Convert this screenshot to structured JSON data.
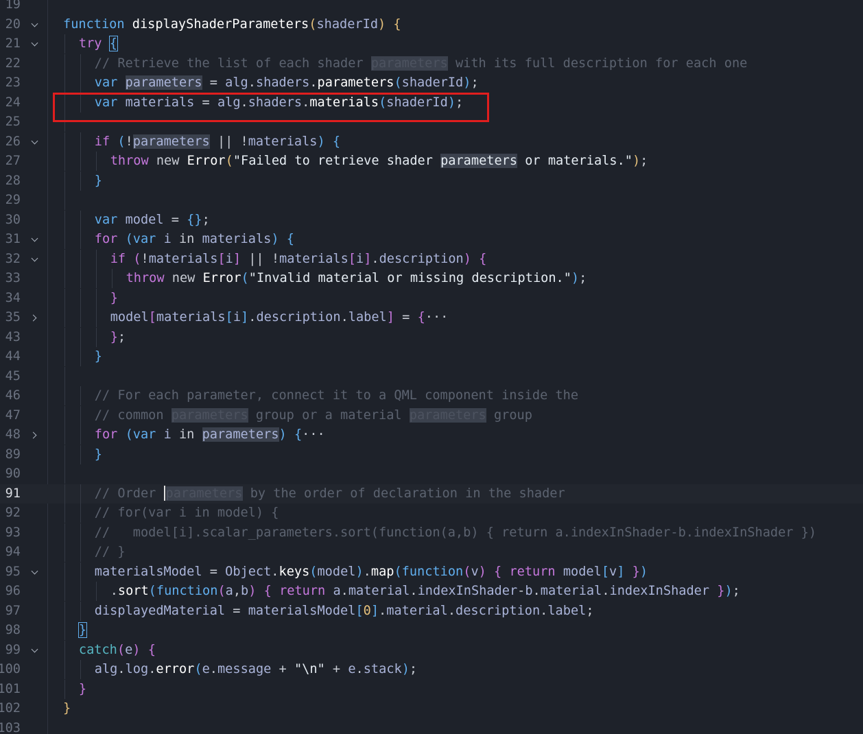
{
  "editor": {
    "current_line": 91,
    "lines": [
      {
        "n": "19",
        "fold": "",
        "segs": []
      },
      {
        "n": "20",
        "fold": "down",
        "segs": [
          [
            "kwb",
            "function"
          ],
          [
            "pl",
            " "
          ],
          [
            "fn",
            "displayShaderParameters"
          ],
          [
            "br1",
            "("
          ],
          [
            "id",
            "shaderId"
          ],
          [
            "br1",
            ")"
          ],
          [
            "pl",
            " "
          ],
          [
            "br1",
            "{"
          ]
        ]
      },
      {
        "n": "21",
        "fold": "down",
        "segs": [
          [
            "kw",
            "try"
          ],
          [
            "pl",
            " "
          ],
          [
            "br2b",
            "{"
          ]
        ]
      },
      {
        "n": "22",
        "fold": "",
        "segs": [
          [
            "cm",
            "// Retrieve the list of each shader "
          ],
          [
            "hlcm",
            "parameters"
          ],
          [
            "cm",
            " with its full description for each one"
          ]
        ]
      },
      {
        "n": "23",
        "fold": "",
        "segs": [
          [
            "kwb",
            "var"
          ],
          [
            "pl",
            " "
          ],
          [
            "hlid",
            "parameters"
          ],
          [
            "pl",
            " = "
          ],
          [
            "id",
            "alg"
          ],
          [
            "pl",
            "."
          ],
          [
            "id",
            "shaders"
          ],
          [
            "pl",
            "."
          ],
          [
            "fnh",
            "parameters"
          ],
          [
            "br3",
            "("
          ],
          [
            "id",
            "shaderId"
          ],
          [
            "br3",
            ")"
          ],
          [
            "pl",
            ";"
          ]
        ]
      },
      {
        "n": "24",
        "fold": "",
        "segs": [
          [
            "kwb",
            "var"
          ],
          [
            "pl",
            " "
          ],
          [
            "id",
            "materials"
          ],
          [
            "pl",
            " = "
          ],
          [
            "id",
            "alg"
          ],
          [
            "pl",
            "."
          ],
          [
            "id",
            "shaders"
          ],
          [
            "pl",
            "."
          ],
          [
            "fn",
            "materials"
          ],
          [
            "br3",
            "("
          ],
          [
            "id",
            "shaderId"
          ],
          [
            "br3",
            ")"
          ],
          [
            "pl",
            ";"
          ]
        ]
      },
      {
        "n": "25",
        "fold": "",
        "segs": []
      },
      {
        "n": "26",
        "fold": "down",
        "segs": [
          [
            "kw",
            "if"
          ],
          [
            "pl",
            " "
          ],
          [
            "br3",
            "("
          ],
          [
            "pl",
            "!"
          ],
          [
            "hlid",
            "parameters"
          ],
          [
            "pl",
            " || !"
          ],
          [
            "id",
            "materials"
          ],
          [
            "br3",
            ")"
          ],
          [
            "pl",
            " "
          ],
          [
            "br3",
            "{"
          ]
        ]
      },
      {
        "n": "27",
        "fold": "",
        "segs": [
          [
            "kw",
            "throw"
          ],
          [
            "pl",
            " new "
          ],
          [
            "fn",
            "Error"
          ],
          [
            "br1",
            "("
          ],
          [
            "str",
            "\"Failed to retrieve shader "
          ],
          [
            "hlstr",
            "parameters"
          ],
          [
            "str",
            " or materials.\""
          ],
          [
            "br1",
            ")"
          ],
          [
            "pl",
            ";"
          ]
        ]
      },
      {
        "n": "28",
        "fold": "",
        "segs": [
          [
            "br3",
            "}"
          ]
        ]
      },
      {
        "n": "29",
        "fold": "",
        "segs": []
      },
      {
        "n": "30",
        "fold": "",
        "segs": [
          [
            "kwb",
            "var"
          ],
          [
            "pl",
            " "
          ],
          [
            "id",
            "model"
          ],
          [
            "pl",
            " = "
          ],
          [
            "br3",
            "{}"
          ],
          [
            "pl",
            ";"
          ]
        ]
      },
      {
        "n": "31",
        "fold": "down",
        "segs": [
          [
            "kw",
            "for"
          ],
          [
            "pl",
            " "
          ],
          [
            "br3",
            "("
          ],
          [
            "kwb",
            "var"
          ],
          [
            "pl",
            " "
          ],
          [
            "id",
            "i"
          ],
          [
            "pl",
            " in "
          ],
          [
            "id",
            "materials"
          ],
          [
            "br3",
            ")"
          ],
          [
            "pl",
            " "
          ],
          [
            "br3",
            "{"
          ]
        ]
      },
      {
        "n": "32",
        "fold": "down",
        "segs": [
          [
            "kw",
            "if"
          ],
          [
            "pl",
            " "
          ],
          [
            "br2",
            "("
          ],
          [
            "pl",
            "!"
          ],
          [
            "id",
            "materials"
          ],
          [
            "br2",
            "["
          ],
          [
            "id",
            "i"
          ],
          [
            "br2",
            "]"
          ],
          [
            "pl",
            " || !"
          ],
          [
            "id",
            "materials"
          ],
          [
            "br2",
            "["
          ],
          [
            "id",
            "i"
          ],
          [
            "br2",
            "]"
          ],
          [
            "pl",
            "."
          ],
          [
            "id",
            "description"
          ],
          [
            "br2",
            ")"
          ],
          [
            "pl",
            " "
          ],
          [
            "br2",
            "{"
          ]
        ]
      },
      {
        "n": "33",
        "fold": "",
        "segs": [
          [
            "kw",
            "throw"
          ],
          [
            "pl",
            " new "
          ],
          [
            "fn",
            "Error"
          ],
          [
            "br3",
            "("
          ],
          [
            "str",
            "\"Invalid material or missing description.\""
          ],
          [
            "br3",
            ")"
          ],
          [
            "pl",
            ";"
          ]
        ]
      },
      {
        "n": "34",
        "fold": "",
        "segs": [
          [
            "br2",
            "}"
          ]
        ]
      },
      {
        "n": "35",
        "fold": "right",
        "segs": [
          [
            "id",
            "model"
          ],
          [
            "br2",
            "["
          ],
          [
            "id",
            "materials"
          ],
          [
            "br3",
            "["
          ],
          [
            "id",
            "i"
          ],
          [
            "br3",
            "]"
          ],
          [
            "pl",
            "."
          ],
          [
            "id",
            "description"
          ],
          [
            "pl",
            "."
          ],
          [
            "id",
            "label"
          ],
          [
            "br2",
            "]"
          ],
          [
            "pl",
            " = "
          ],
          [
            "br2",
            "{"
          ],
          [
            "pl",
            "···"
          ]
        ]
      },
      {
        "n": "43",
        "fold": "",
        "segs": [
          [
            "br2",
            "}"
          ],
          [
            "pl",
            ";"
          ]
        ]
      },
      {
        "n": "44",
        "fold": "",
        "segs": [
          [
            "br3",
            "}"
          ]
        ]
      },
      {
        "n": "45",
        "fold": "",
        "segs": []
      },
      {
        "n": "46",
        "fold": "",
        "segs": [
          [
            "cm",
            "// For each parameter, connect it to a QML component inside the"
          ]
        ]
      },
      {
        "n": "47",
        "fold": "",
        "segs": [
          [
            "cm",
            "// common "
          ],
          [
            "hlcm",
            "parameters"
          ],
          [
            "cm",
            " group or a material "
          ],
          [
            "hlcm",
            "parameters"
          ],
          [
            "cm",
            " group"
          ]
        ]
      },
      {
        "n": "48",
        "fold": "right",
        "segs": [
          [
            "kw",
            "for"
          ],
          [
            "pl",
            " "
          ],
          [
            "br3",
            "("
          ],
          [
            "kwb",
            "var"
          ],
          [
            "pl",
            " "
          ],
          [
            "id",
            "i"
          ],
          [
            "pl",
            " in "
          ],
          [
            "hlid",
            "parameters"
          ],
          [
            "br3",
            ")"
          ],
          [
            "pl",
            " "
          ],
          [
            "br3",
            "{"
          ],
          [
            "pl",
            "···"
          ]
        ]
      },
      {
        "n": "89",
        "fold": "",
        "segs": [
          [
            "br3",
            "}"
          ]
        ]
      },
      {
        "n": "90",
        "fold": "",
        "segs": []
      },
      {
        "n": "91",
        "fold": "",
        "segs": [
          [
            "cm",
            "// Order "
          ],
          [
            "cursor",
            ""
          ],
          [
            "hlcm",
            "parameters"
          ],
          [
            "cm",
            " by the order of declaration in the shader"
          ]
        ]
      },
      {
        "n": "92",
        "fold": "",
        "segs": [
          [
            "cm",
            "// for(var i in model) {"
          ]
        ]
      },
      {
        "n": "93",
        "fold": "",
        "segs": [
          [
            "cm",
            "//   model[i].scalar_parameters.sort(function(a,b) { return a.indexInShader-b.indexInShader })"
          ]
        ]
      },
      {
        "n": "94",
        "fold": "",
        "segs": [
          [
            "cm",
            "// }"
          ]
        ]
      },
      {
        "n": "95",
        "fold": "down",
        "segs": [
          [
            "id",
            "materialsModel"
          ],
          [
            "pl",
            " = "
          ],
          [
            "id",
            "Object"
          ],
          [
            "pl",
            "."
          ],
          [
            "fn",
            "keys"
          ],
          [
            "br3",
            "("
          ],
          [
            "id",
            "model"
          ],
          [
            "br3",
            ")"
          ],
          [
            "pl",
            "."
          ],
          [
            "fn",
            "map"
          ],
          [
            "br3",
            "("
          ],
          [
            "kwb",
            "function"
          ],
          [
            "br2",
            "("
          ],
          [
            "id",
            "v"
          ],
          [
            "br2",
            ")"
          ],
          [
            "pl",
            " "
          ],
          [
            "br2",
            "{"
          ],
          [
            "pl",
            " "
          ],
          [
            "kw",
            "return"
          ],
          [
            "pl",
            " "
          ],
          [
            "id",
            "model"
          ],
          [
            "br3",
            "["
          ],
          [
            "id",
            "v"
          ],
          [
            "br3",
            "]"
          ],
          [
            "pl",
            " "
          ],
          [
            "br2",
            "}"
          ],
          [
            "br3",
            ")"
          ]
        ]
      },
      {
        "n": "96",
        "fold": "",
        "segs": [
          [
            "pl",
            "."
          ],
          [
            "fn",
            "sort"
          ],
          [
            "br3",
            "("
          ],
          [
            "kwb",
            "function"
          ],
          [
            "br2",
            "("
          ],
          [
            "id",
            "a"
          ],
          [
            "pl",
            ","
          ],
          [
            "id",
            "b"
          ],
          [
            "br2",
            ")"
          ],
          [
            "pl",
            " "
          ],
          [
            "br2",
            "{"
          ],
          [
            "pl",
            " "
          ],
          [
            "kw",
            "return"
          ],
          [
            "pl",
            " "
          ],
          [
            "id",
            "a"
          ],
          [
            "pl",
            "."
          ],
          [
            "id",
            "material"
          ],
          [
            "pl",
            "."
          ],
          [
            "id",
            "indexInShader"
          ],
          [
            "pl",
            "-"
          ],
          [
            "id",
            "b"
          ],
          [
            "pl",
            "."
          ],
          [
            "id",
            "material"
          ],
          [
            "pl",
            "."
          ],
          [
            "id",
            "indexInShader"
          ],
          [
            "pl",
            " "
          ],
          [
            "br2",
            "}"
          ],
          [
            "br3",
            ")"
          ],
          [
            "pl",
            ";"
          ]
        ]
      },
      {
        "n": "97",
        "fold": "",
        "segs": [
          [
            "id",
            "displayedMaterial"
          ],
          [
            "pl",
            " = "
          ],
          [
            "id",
            "materialsModel"
          ],
          [
            "br3",
            "["
          ],
          [
            "num",
            "0"
          ],
          [
            "br3",
            "]"
          ],
          [
            "pl",
            "."
          ],
          [
            "id",
            "material"
          ],
          [
            "pl",
            "."
          ],
          [
            "id",
            "description"
          ],
          [
            "pl",
            "."
          ],
          [
            "id",
            "label"
          ],
          [
            "pl",
            ";"
          ]
        ]
      },
      {
        "n": "98",
        "fold": "",
        "segs": [
          [
            "br2b",
            "}"
          ]
        ]
      },
      {
        "n": "99",
        "fold": "down",
        "segs": [
          [
            "kw2",
            "catch"
          ],
          [
            "br2",
            "("
          ],
          [
            "id",
            "e"
          ],
          [
            "br2",
            ")"
          ],
          [
            "pl",
            " "
          ],
          [
            "br2",
            "{"
          ]
        ]
      },
      {
        "n": "100",
        "fold": "",
        "segs": [
          [
            "id",
            "alg"
          ],
          [
            "pl",
            "."
          ],
          [
            "id",
            "log"
          ],
          [
            "pl",
            "."
          ],
          [
            "fn",
            "error"
          ],
          [
            "br3",
            "("
          ],
          [
            "id",
            "e"
          ],
          [
            "pl",
            "."
          ],
          [
            "id",
            "message"
          ],
          [
            "pl",
            " + "
          ],
          [
            "str",
            "\"\\n\""
          ],
          [
            "pl",
            " + "
          ],
          [
            "id",
            "e"
          ],
          [
            "pl",
            "."
          ],
          [
            "id",
            "stack"
          ],
          [
            "br3",
            ")"
          ],
          [
            "pl",
            ";"
          ]
        ]
      },
      {
        "n": "101",
        "fold": "",
        "segs": [
          [
            "br2",
            "}"
          ]
        ]
      },
      {
        "n": "102",
        "fold": "",
        "segs": [
          [
            "br1",
            "}"
          ]
        ]
      },
      {
        "n": "103",
        "fold": "",
        "segs": []
      }
    ]
  }
}
